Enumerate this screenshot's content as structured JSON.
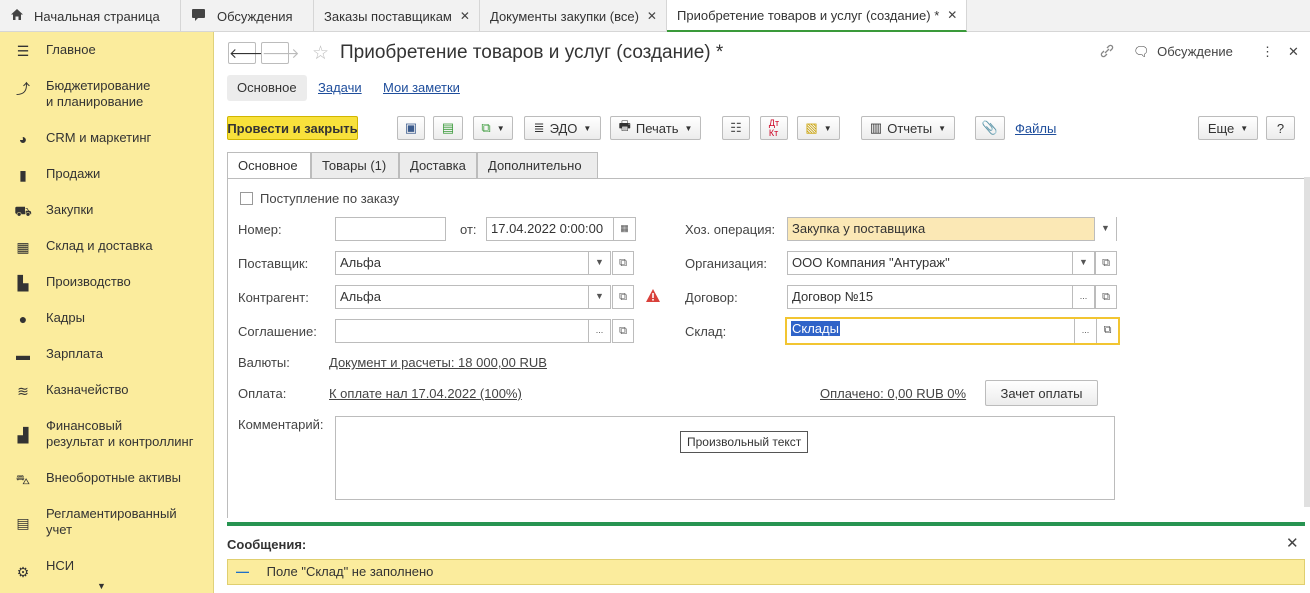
{
  "top_tabs": [
    {
      "label": "Начальная страница",
      "closable": false
    },
    {
      "label": "Обсуждения",
      "closable": false
    },
    {
      "label": "Заказы поставщикам",
      "closable": true
    },
    {
      "label": "Документы закупки (все)",
      "closable": true
    },
    {
      "label": "Приобретение товаров и услуг (создание) *",
      "closable": true,
      "active": true
    }
  ],
  "sidebar": {
    "items": [
      {
        "label": "Главное",
        "icon": "menu-icon"
      },
      {
        "label": "Бюджетирование и планирование",
        "line1": "Бюджетирование",
        "line2": "и планирование",
        "icon": "chart-icon"
      },
      {
        "label": "CRM и маркетинг",
        "icon": "pie-icon"
      },
      {
        "label": "Продажи",
        "icon": "bag-icon"
      },
      {
        "label": "Закупки",
        "icon": "cart-icon"
      },
      {
        "label": "Склад и доставка",
        "icon": "grid-icon"
      },
      {
        "label": "Производство",
        "icon": "factory-icon"
      },
      {
        "label": "Кадры",
        "icon": "person-icon"
      },
      {
        "label": "Зарплата",
        "icon": "card-icon"
      },
      {
        "label": "Казначейство",
        "icon": "coins-icon"
      },
      {
        "label": "Финансовый результат и контроллинг",
        "line1": "Финансовый",
        "line2": "результат и контроллинг",
        "icon": "bars-icon"
      },
      {
        "label": "Внеоборотные активы",
        "icon": "truck-icon"
      },
      {
        "label": "Регламентированный учет",
        "line1": "Регламентированный",
        "line2": "учет",
        "icon": "calculator-icon"
      },
      {
        "label": "НСИ",
        "icon": "gear-icon"
      }
    ]
  },
  "header": {
    "title": "Приобретение товаров и услуг (создание) *",
    "discussion": "Обсуждение"
  },
  "subtabs": {
    "main": "Основное",
    "tasks": "Задачи",
    "notes": "Мои заметки"
  },
  "toolbar": {
    "post_close": "Провести и закрыть",
    "edo": "ЭДО",
    "print": "Печать",
    "reports": "Отчеты",
    "files": "Файлы",
    "more": "Еще",
    "help": "?"
  },
  "form_tabs": [
    "Основное",
    "Товары (1)",
    "Доставка",
    "Дополнительно"
  ],
  "form": {
    "checkbox_label": "Поступление по заказу",
    "number_label": "Номер:",
    "number_value": "",
    "from_label": "от:",
    "date_value": "17.04.2022  0:00:00",
    "supplier_label": "Поставщик:",
    "supplier_value": "Альфа",
    "counterparty_label": "Контрагент:",
    "counterparty_value": "Альфа",
    "agreement_label": "Соглашение:",
    "agreement_value": "",
    "currency_label": "Валюты:",
    "currency_link": "Документ и расчеты: 18 000,00 RUB",
    "payment_label": "Оплата:",
    "payment_link": "К оплате нал 17.04.2022 (100%)",
    "paid_link": "Оплачено: 0,00 RUB 0%",
    "offset_button": "Зачет оплаты",
    "comment_label": "Комментарий:",
    "comment_tooltip": "Произвольный текст",
    "operation_label": "Хоз. операция:",
    "operation_value": "Закупка у поставщика",
    "organization_label": "Организация:",
    "organization_value": "ООО Компания \"Антураж\"",
    "contract_label": "Договор:",
    "contract_value": "Договор №15",
    "warehouse_label": "Склад:",
    "warehouse_value": "Склады"
  },
  "messages": {
    "title": "Сообщения:",
    "items": [
      "Поле \"Склад\" не заполнено"
    ]
  },
  "colors": {
    "sidebar_bg": "#fbec9d",
    "primary_button": "#f8e13b",
    "link": "#1f4e9c",
    "active_tab_underline": "#3a9a3a",
    "message_bar": "#279451",
    "warning": "#d9413b"
  }
}
